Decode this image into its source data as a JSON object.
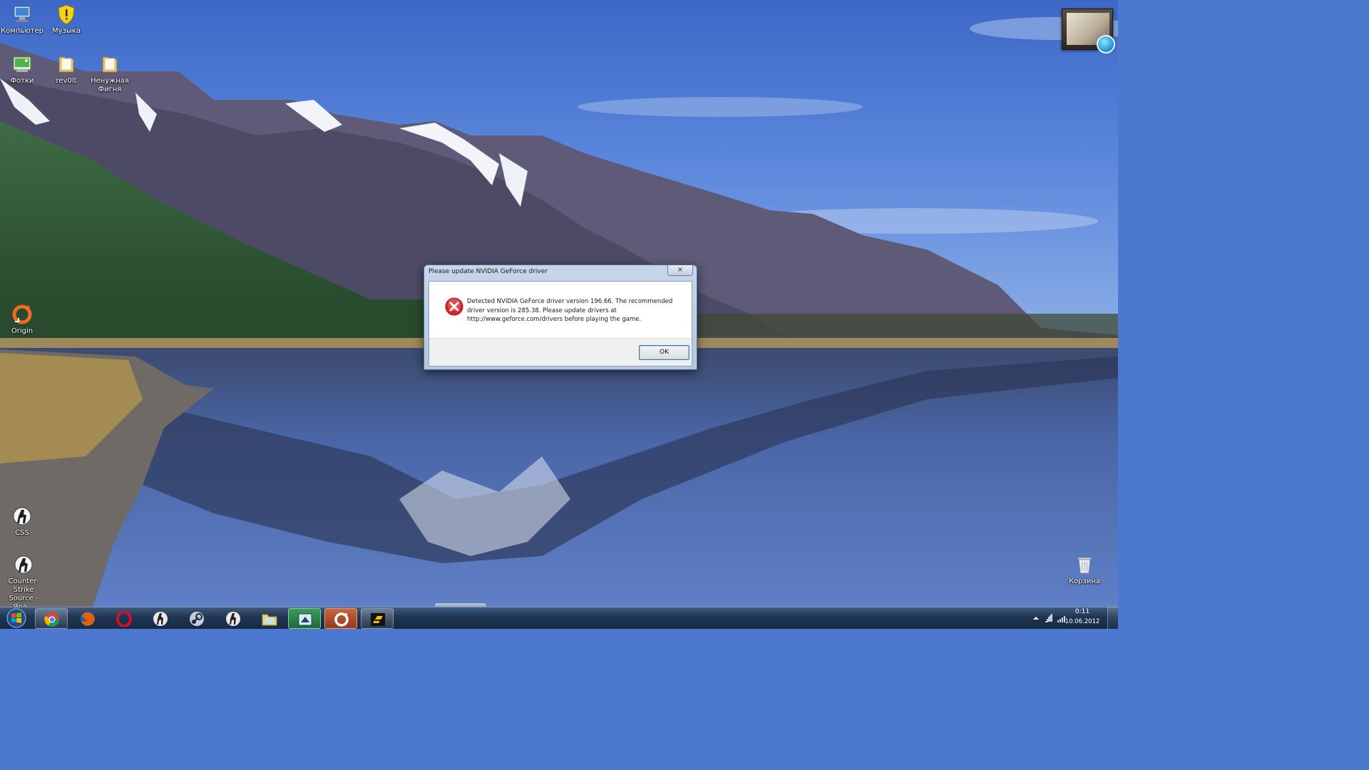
{
  "desktop": {
    "icons": [
      {
        "label": "Компьютер",
        "icon": "computer-icon"
      },
      {
        "label": "Музыка",
        "icon": "shield-folder-icon"
      },
      {
        "label": "Фотки",
        "icon": "photos-icon"
      },
      {
        "label": "rev0lt",
        "icon": "folder-icon"
      },
      {
        "label": "Ненужная Фигня",
        "icon": "folder-icon"
      },
      {
        "label": "Origin",
        "icon": "origin-icon"
      },
      {
        "label": "CSS",
        "icon": "counter-strike-icon"
      },
      {
        "label": "Counter-Strike Source - Ярл...",
        "icon": "counter-strike-icon"
      },
      {
        "label": "Корзина",
        "icon": "recycle-bin-icon"
      }
    ]
  },
  "dialog": {
    "title": "Please update NVIDIA GeForce driver",
    "close_label": "×",
    "message_lines": [
      "Detected NVIDIA GeForce driver version 196.66. The recommended",
      "driver version is 285.38. Please update drivers at",
      "http://www.geforce.com/drivers before playing the game."
    ],
    "ok_label": "OK",
    "icon": "error-icon"
  },
  "taskbar": {
    "start": "windows-start-icon",
    "pinned": [
      "chrome-icon",
      "firefox-icon",
      "opera-icon",
      "counter-strike-icon",
      "steam-icon",
      "counter-strike-icon",
      "folder-icon",
      "game-launcher-icon",
      "origin-icon",
      "need-for-speed-icon"
    ],
    "tray_icons": [
      "show-hidden-icons-icon",
      "network-icon",
      "signal-icon"
    ],
    "clock_time": "0:11",
    "clock_date": "10.06.2012"
  },
  "colors": {
    "sky": "#4a76d2",
    "taskbar": "#1f3450",
    "dialog_frame": "#b4c7df",
    "error_red": "#d8262d"
  }
}
